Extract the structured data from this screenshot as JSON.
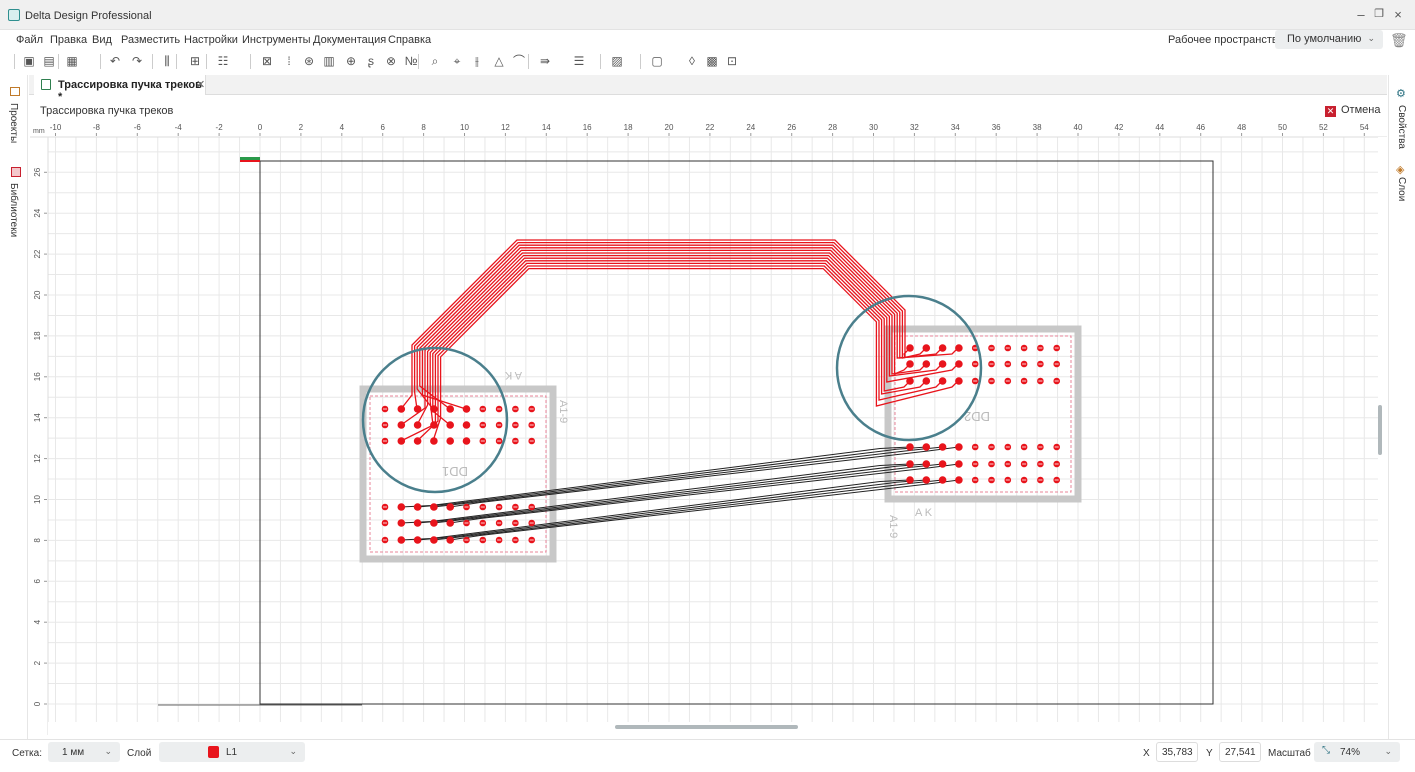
{
  "app": {
    "title": "Delta Design Professional"
  },
  "menu": [
    "Файл",
    "Правка",
    "Вид",
    "Разместить",
    "Настройки",
    "Инструменты",
    "Документация",
    "Справка"
  ],
  "workspace": {
    "label": "Рабочее пространство",
    "value": "По умолчанию"
  },
  "toolbar_icons": [
    "save-icon",
    "save-all-icon",
    "table-icon",
    "undo-icon",
    "redo-icon",
    "align-icon",
    "grid-select-icon",
    "layout-icon",
    "fanout-icon",
    "pads-icon",
    "via-icon",
    "component-icon",
    "crosshair-icon",
    "route-icon",
    "array-icon",
    "numbering-icon",
    "probe-icon",
    "route-interactive-icon",
    "bundle-route-icon",
    "triangle-icon",
    "arc-icon",
    "align-traces-icon",
    "distribute-icon",
    "fill-icon",
    "board-icon",
    "drop-icon",
    "drc-icon",
    "text-icon"
  ],
  "tab": {
    "label": "Трассировка пучка треков *"
  },
  "left_panel": [
    "Проекты",
    "Библиотеки"
  ],
  "right_panel": [
    "Свойства",
    "Слои"
  ],
  "mode": {
    "title": "Трассировка пучка треков",
    "cancel": "Отмена"
  },
  "ruler": {
    "unit": "mm",
    "x_ticks": [
      -10,
      -8,
      -6,
      -4,
      -2,
      0,
      2,
      4,
      6,
      8,
      10,
      12,
      14,
      16,
      18,
      20,
      22,
      24,
      26,
      28,
      30,
      32,
      34,
      36,
      38,
      40,
      42,
      44,
      46,
      48,
      50,
      52,
      54
    ],
    "y_ticks": [
      0,
      2,
      4,
      6,
      8,
      10,
      12,
      14,
      16,
      18,
      20,
      22,
      24,
      26
    ]
  },
  "components": [
    {
      "ref": "DD1",
      "label": "A K",
      "pins": "A1-9"
    },
    {
      "ref": "DD2",
      "label": "A K",
      "pins": "A1-9"
    }
  ],
  "colors": {
    "trace": "#e8141c",
    "bundle": "#222222",
    "highlight": "#4a7f8c",
    "outline": "#c8c8c8",
    "keepout": "#e8849a"
  },
  "status": {
    "grid_label": "Сетка:",
    "grid_value": "1 мм",
    "layer_label": "Слой",
    "layer_value": "L1",
    "layer_color": "#e8141c",
    "x_label": "X",
    "x_value": "35,783",
    "y_label": "Y",
    "y_value": "27,541",
    "scale_label": "Масштаб",
    "scale_value": "74%"
  }
}
